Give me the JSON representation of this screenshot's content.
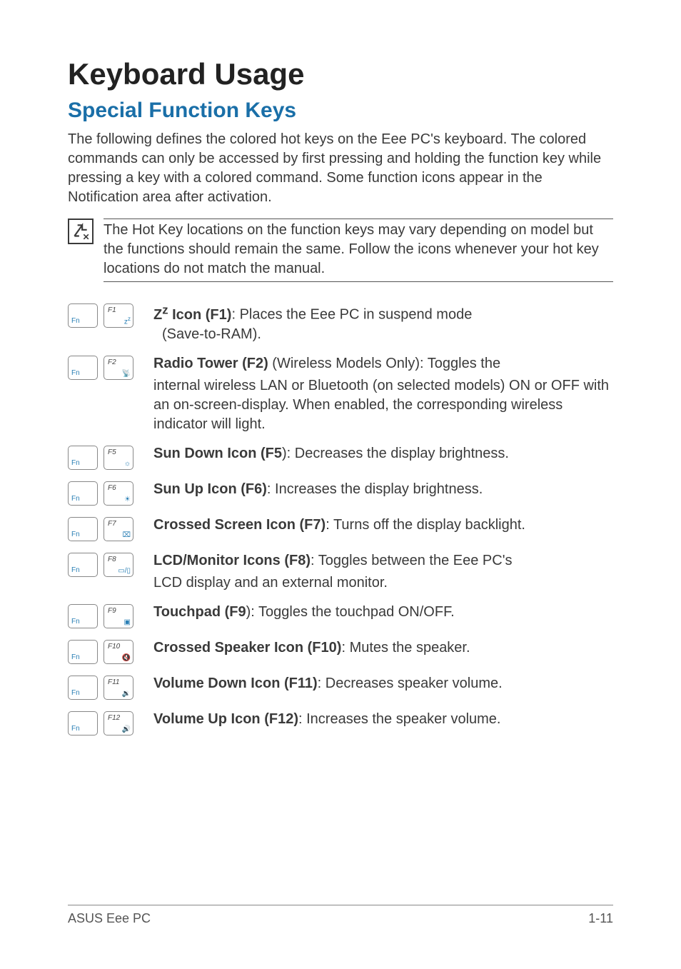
{
  "title": "Keyboard Usage",
  "section": "Special Function Keys",
  "intro": "The following defines the colored hot keys on the Eee PC's keyboard. The colored commands can only be accessed by first pressing and holding the function key while pressing a key with a colored command. Some function icons appear in the Notification area after activation.",
  "note": "The Hot Key locations on the function keys may vary depending on model but the functions should remain the same. Follow the icons whenever your hot key locations do not match the manual.",
  "keys": {
    "fn": "Fn",
    "f1": "F1",
    "f2": "F2",
    "f5": "F5",
    "f6": "F6",
    "f7": "F7",
    "f8": "F8",
    "f9": "F9",
    "f10": "F10",
    "f11": "F11",
    "f12": "F12"
  },
  "items": {
    "f1": {
      "label": "Zz Icon (F1)",
      "sep": ": ",
      "desc": "Places the Eee PC in suspend mode",
      "desc2": "(Save-to-RAM)."
    },
    "f2": {
      "label": "Radio Tower (F2)",
      "mid": " (Wireless Models Only): ",
      "desc": "Toggles the",
      "desc2": "internal wireless LAN or Bluetooth (on selected models) ON or OFF with an on-screen-display. When enabled, the corresponding wireless indicator will light."
    },
    "f5": {
      "label": "Sun Down Icon (F5",
      "sep": "): ",
      "desc": "Decreases the display brightness."
    },
    "f6": {
      "label": "Sun Up Icon (F6)",
      "sep": ": ",
      "desc": "Increases the display brightness."
    },
    "f7": {
      "label": "Crossed Screen Icon (F7)",
      "sep": ": ",
      "desc": "Turns off the display backlight."
    },
    "f8": {
      "label": "LCD/Monitor Icons (F8)",
      "sep": ": ",
      "desc": "Toggles between the Eee PC's",
      "desc2": "LCD display and an external monitor."
    },
    "f9": {
      "label": "Touchpad (F9",
      "sep": "): ",
      "desc": "Toggles the touchpad ON/OFF."
    },
    "f10": {
      "label": "Crossed Speaker Icon (F10)",
      "sep": ": ",
      "desc": "Mutes the speaker."
    },
    "f11": {
      "label": "Volume Down Icon (F11)",
      "sep": ": ",
      "desc": "Decreases speaker volume."
    },
    "f12": {
      "label": "Volume Up Icon (F12)",
      "sep": ": ",
      "desc": "Increases the speaker volume."
    }
  },
  "footer": {
    "left": "ASUS Eee PC",
    "right": "1-11"
  }
}
